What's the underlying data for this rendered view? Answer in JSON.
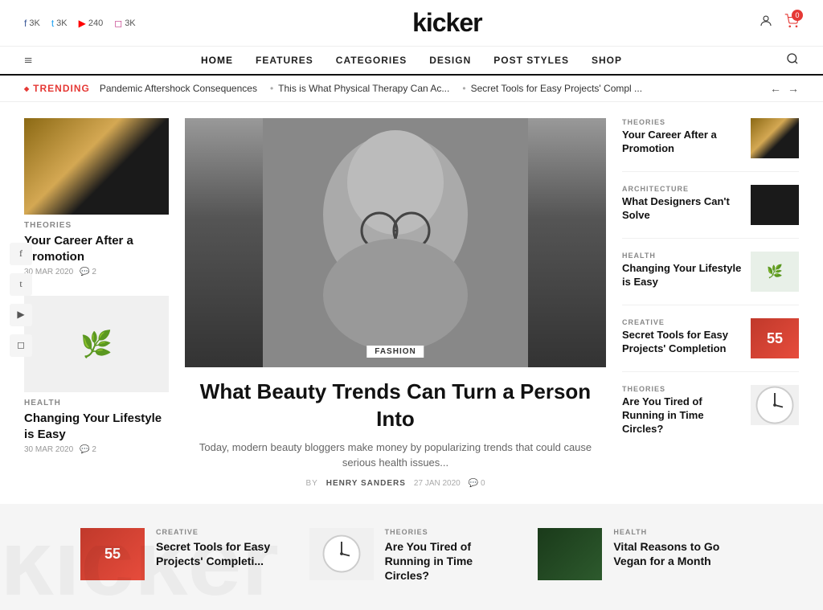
{
  "site": {
    "logo": "kicker"
  },
  "topbar": {
    "social": [
      {
        "icon": "f",
        "label": "3K",
        "class": "fb"
      },
      {
        "icon": "t",
        "label": "3K",
        "class": "tw"
      },
      {
        "icon": "▶",
        "label": "240",
        "class": "yt"
      },
      {
        "icon": "◻",
        "label": "3K",
        "class": "ig"
      }
    ],
    "cart_count": "0"
  },
  "nav": {
    "hamburger": "≡",
    "items": [
      {
        "label": "HOME",
        "active": true
      },
      {
        "label": "FEATURES"
      },
      {
        "label": "CATEGORIES"
      },
      {
        "label": "DESIGN"
      },
      {
        "label": "POST STYLES"
      },
      {
        "label": "SHOP"
      }
    ]
  },
  "trending": {
    "label": "TRENDING",
    "items": [
      "Pandemic Aftershock Consequences",
      "This is What Physical Therapy Can Ac...",
      "Secret Tools for Easy Projects' Compl ..."
    ]
  },
  "left_articles": [
    {
      "category": "THEORIES",
      "title": "Your Career After a Promotion",
      "date": "30 MAR 2020",
      "comments": "2",
      "img_class": "img-architecture"
    },
    {
      "category": "HEALTH",
      "title": "Changing Your Lifestyle is Easy",
      "date": "30 MAR 2020",
      "comments": "2",
      "img_class": "img-plant"
    }
  ],
  "feature": {
    "tag": "FASHION",
    "title": "What Beauty Trends Can Turn a Person Into",
    "excerpt": "Today, modern beauty bloggers make money by popularizing trends that could cause serious health issues...",
    "author": "HENRY SANDERS",
    "date": "27 JAN 2020",
    "comments": "0"
  },
  "right_articles": [
    {
      "category": "THEORIES",
      "title": "Your Career After a Promotion",
      "img_class": "img-architecture"
    },
    {
      "category": "ARCHITECTURE",
      "title": "What Designers Can't Solve",
      "img_class": "img-arch-dark"
    },
    {
      "category": "HEALTH",
      "title": "Changing Your Lifestyle is Easy",
      "img_class": "img-plant-sm"
    },
    {
      "category": "CREATIVE",
      "title": "Secret Tools for Easy Projects' Completion",
      "img_class": "img-red-tools"
    },
    {
      "category": "THEORIES",
      "title": "Are You Tired of Running in Time Circles?",
      "img_class": "img-clock"
    }
  ],
  "bottom_articles": [
    {
      "category": "CREATIVE",
      "title": "Secret Tools for Easy Projects' Completi...",
      "img_class": "img-red-tools"
    },
    {
      "category": "THEORIES",
      "title": "Are You Tired of Running in Time Circles?",
      "img_class": "img-clock"
    },
    {
      "category": "HEALTH",
      "title": "Vital Reasons to Go Vegan for a Month",
      "img_class": "img-dark-leaves"
    }
  ],
  "social_sidebar": [
    {
      "icon": "f",
      "name": "facebook"
    },
    {
      "icon": "t",
      "name": "twitter"
    },
    {
      "icon": "▶",
      "name": "youtube"
    },
    {
      "icon": "◻",
      "name": "instagram"
    }
  ]
}
